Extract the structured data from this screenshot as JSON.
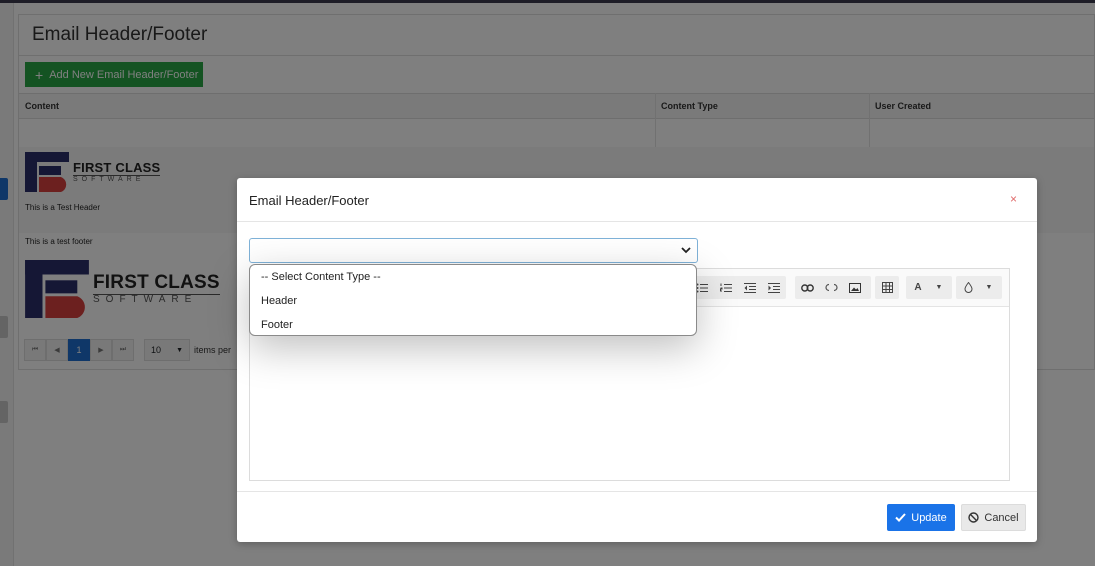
{
  "page": {
    "title": "Email Header/Footer",
    "add_button_label": "Add New Email Header/Footer",
    "columns": [
      "Content",
      "Content Type",
      "User Created"
    ],
    "logo_text_line1": "FIRST CLASS",
    "logo_text_line2": "SOFTWARE",
    "header_sample_text": "This is a Test Header",
    "footer_sample_text": "This is a test footer",
    "pager": {
      "current_page": "1",
      "page_size": "10",
      "items_label": "items per"
    }
  },
  "modal": {
    "title": "Email Header/Footer",
    "close_symbol": "×",
    "select_options": [
      "-- Select Content Type --",
      "Header",
      "Footer"
    ],
    "update_label": "Update",
    "cancel_label": "Cancel"
  },
  "colors": {
    "primary": "#1a73e8",
    "success": "#28a745",
    "close": "#e06a6a",
    "logo_navy": "#2b2e6b",
    "logo_red": "#d8403f"
  },
  "icons": [
    "plus-icon",
    "chevron-down-icon",
    "close-icon",
    "check-icon",
    "ban-icon",
    "list-ul-icon",
    "list-ol-icon",
    "outdent-icon",
    "indent-icon",
    "link-icon",
    "unlink-icon",
    "image-icon",
    "table-icon",
    "font-color-icon",
    "fill-color-icon"
  ]
}
